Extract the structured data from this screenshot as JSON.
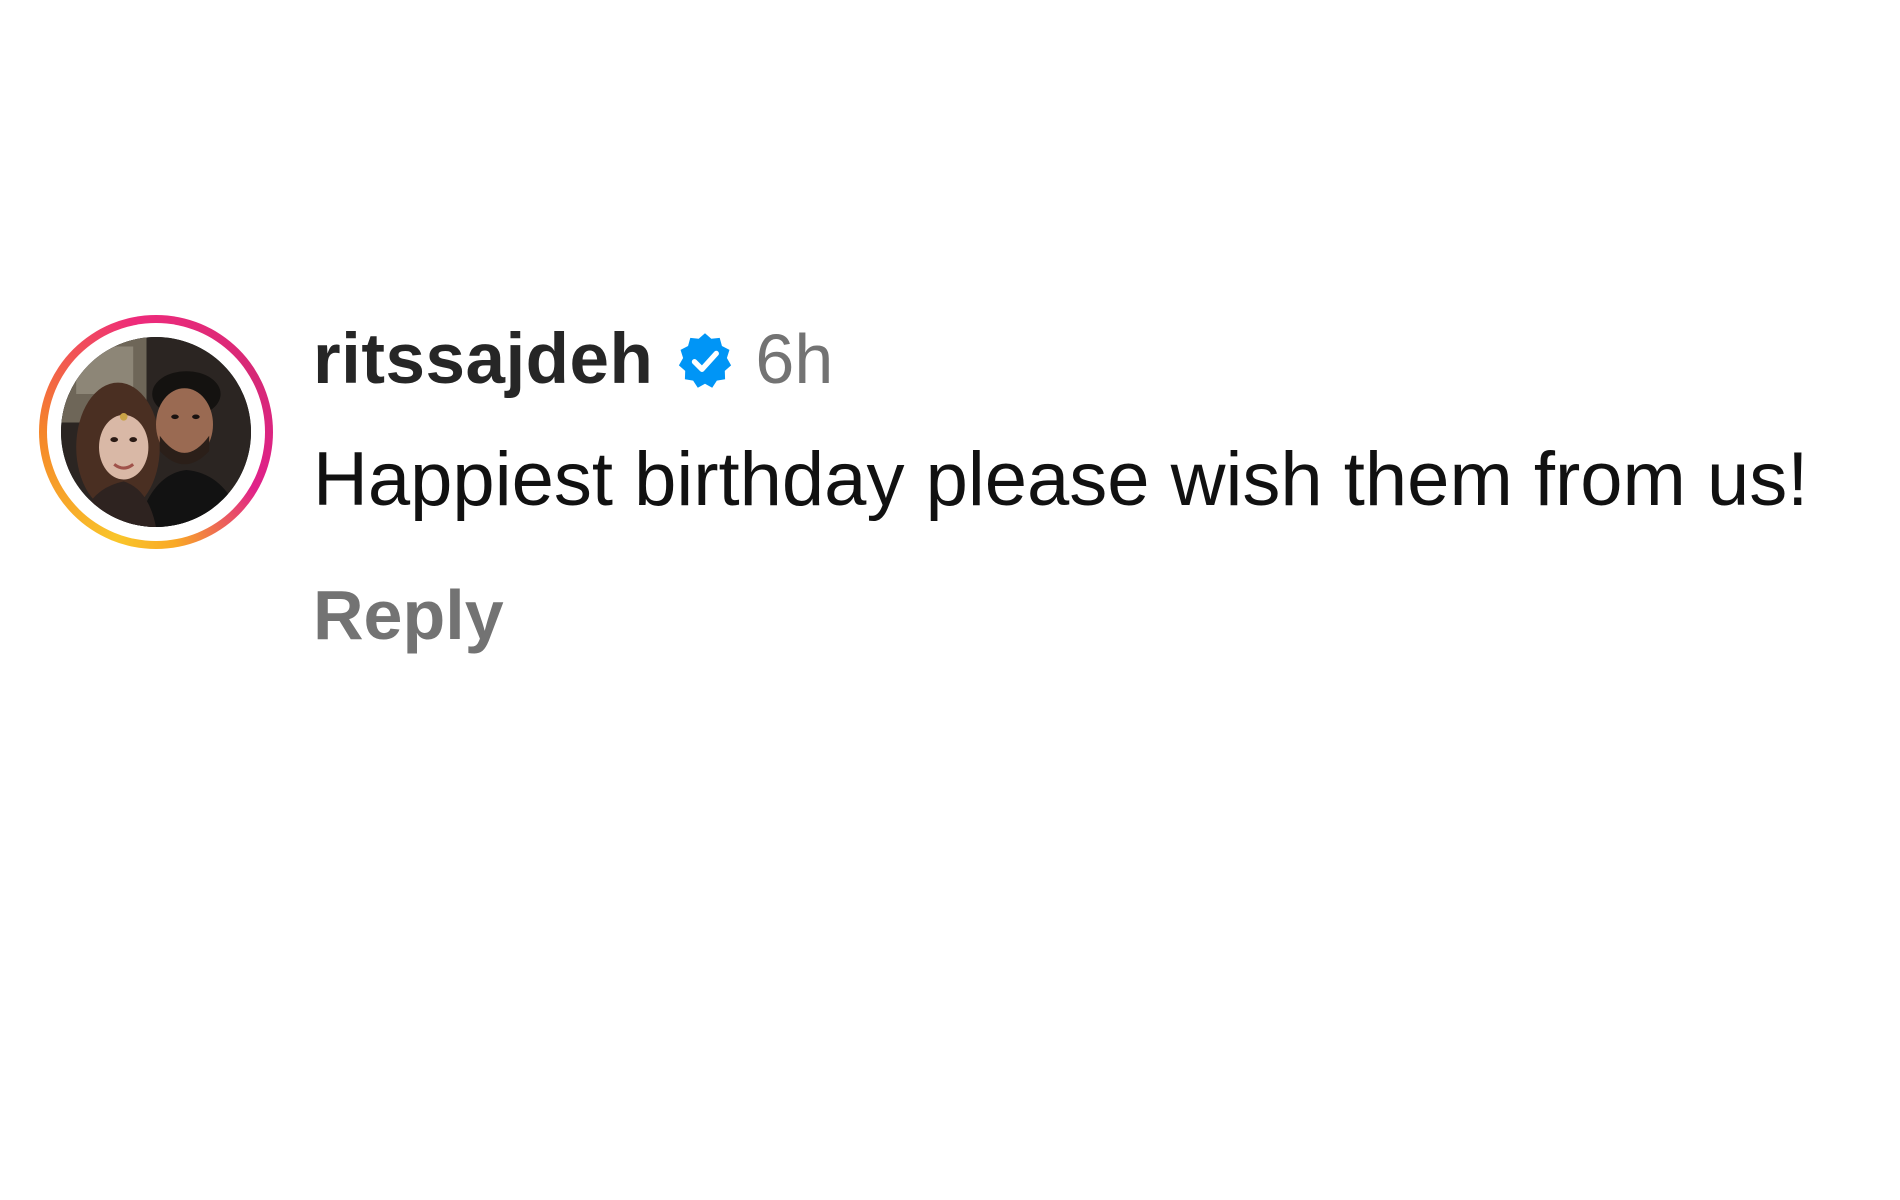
{
  "comment": {
    "username": "ritssajdeh",
    "verified": true,
    "timestamp": "6h",
    "text": "Happiest birthday please wish them from us!",
    "reply_label": "Reply"
  },
  "avatar": {
    "story_ring": true
  },
  "colors": {
    "username": "#262626",
    "meta_gray": "#737373",
    "verified_blue": "#0095f6",
    "ring_gradient": [
      "#f9c52a",
      "#f58529",
      "#ee2a7b",
      "#d62976"
    ]
  },
  "icons": {
    "verified": "verified-badge-icon"
  }
}
